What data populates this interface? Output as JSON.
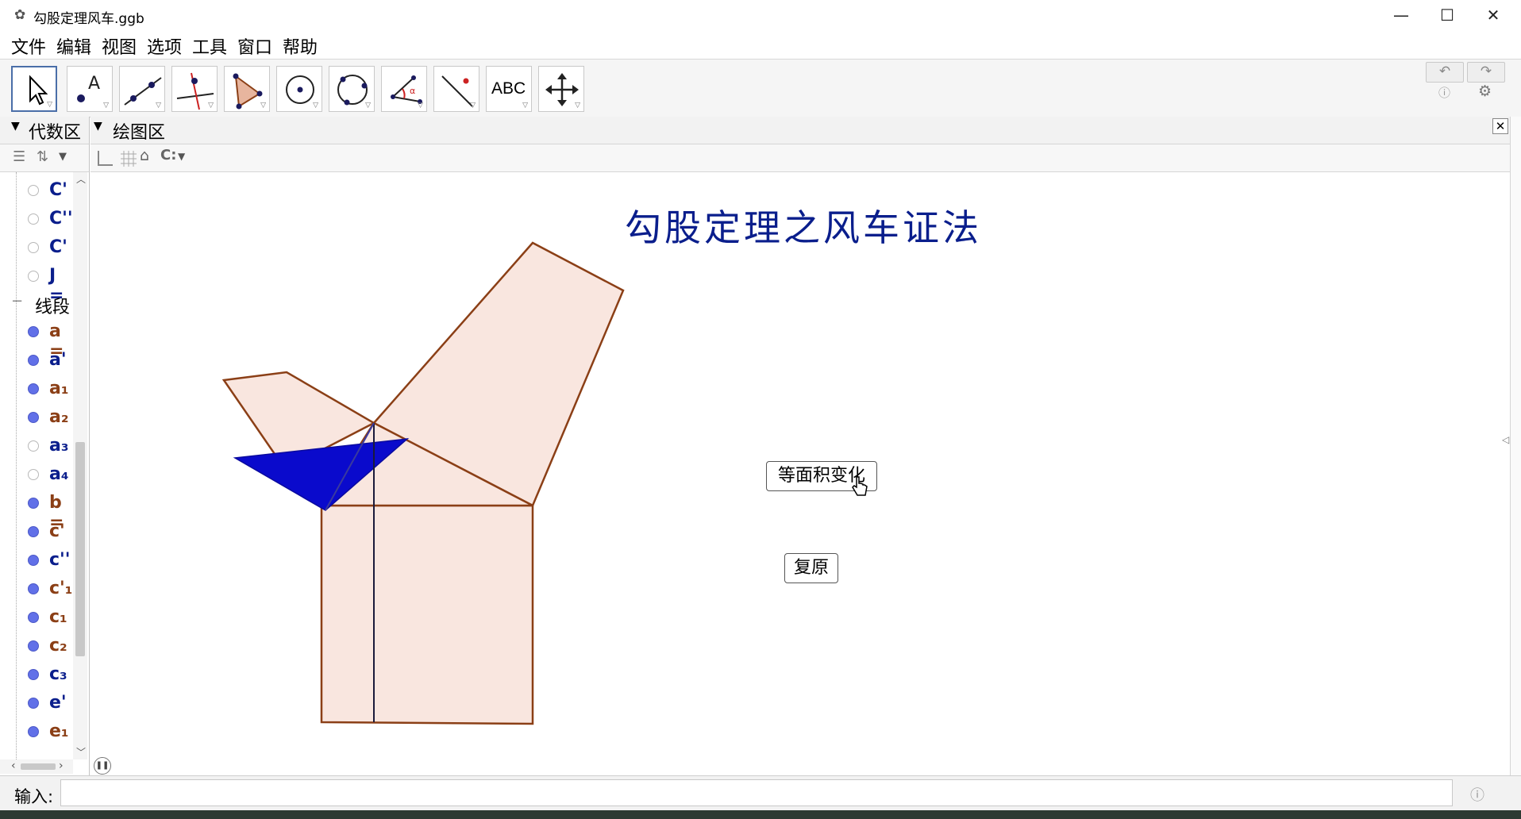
{
  "window": {
    "title": "勾股定理风车.ggb"
  },
  "menu": [
    "文件",
    "编辑",
    "视图",
    "选项",
    "工具",
    "窗口",
    "帮助"
  ],
  "toolbar": {
    "tools": [
      "move-tool",
      "point-tool",
      "line-tool",
      "perpendicular-line-tool",
      "polygon-tool",
      "circle-center-point-tool",
      "circle-three-points-tool",
      "angle-tool",
      "reflect-tool",
      "text-tool",
      "move-view-tool"
    ],
    "text_tool_label": "ABC"
  },
  "algebra": {
    "header": "代数区",
    "group_label": "线段",
    "items": [
      {
        "label": "C'",
        "visible": false,
        "color": "blue"
      },
      {
        "label": "C''",
        "visible": false,
        "color": "blue"
      },
      {
        "label": "C'",
        "visible": false,
        "color": "blue"
      },
      {
        "label": "J =",
        "visible": false,
        "color": "blue"
      },
      {
        "label": "a =",
        "visible": true,
        "color": "brown"
      },
      {
        "label": "a'",
        "visible": true,
        "color": "blue"
      },
      {
        "label": "a₁",
        "visible": true,
        "color": "brown"
      },
      {
        "label": "a₂",
        "visible": true,
        "color": "brown"
      },
      {
        "label": "a₃",
        "visible": false,
        "color": "blue"
      },
      {
        "label": "a₄",
        "visible": false,
        "color": "blue"
      },
      {
        "label": "b =",
        "visible": true,
        "color": "brown"
      },
      {
        "label": "c'",
        "visible": true,
        "color": "brown"
      },
      {
        "label": "c''",
        "visible": true,
        "color": "blue"
      },
      {
        "label": "c'₁",
        "visible": true,
        "color": "brown"
      },
      {
        "label": "c₁",
        "visible": true,
        "color": "brown"
      },
      {
        "label": "c₂",
        "visible": true,
        "color": "brown"
      },
      {
        "label": "c₃",
        "visible": true,
        "color": "blue"
      },
      {
        "label": "e'",
        "visible": true,
        "color": "blue"
      },
      {
        "label": "e₁",
        "visible": true,
        "color": "brown"
      }
    ]
  },
  "graphics": {
    "header": "绘图区",
    "title_text": "勾股定理之风车证法",
    "button_transform": "等面积变化",
    "button_reset": "复原"
  },
  "input": {
    "label": "输入:",
    "value": ""
  },
  "colors": {
    "fill": "#f9e6df",
    "stroke": "#8b3f16",
    "triangle": "#0a0acc",
    "title": "#0a1e8c"
  }
}
